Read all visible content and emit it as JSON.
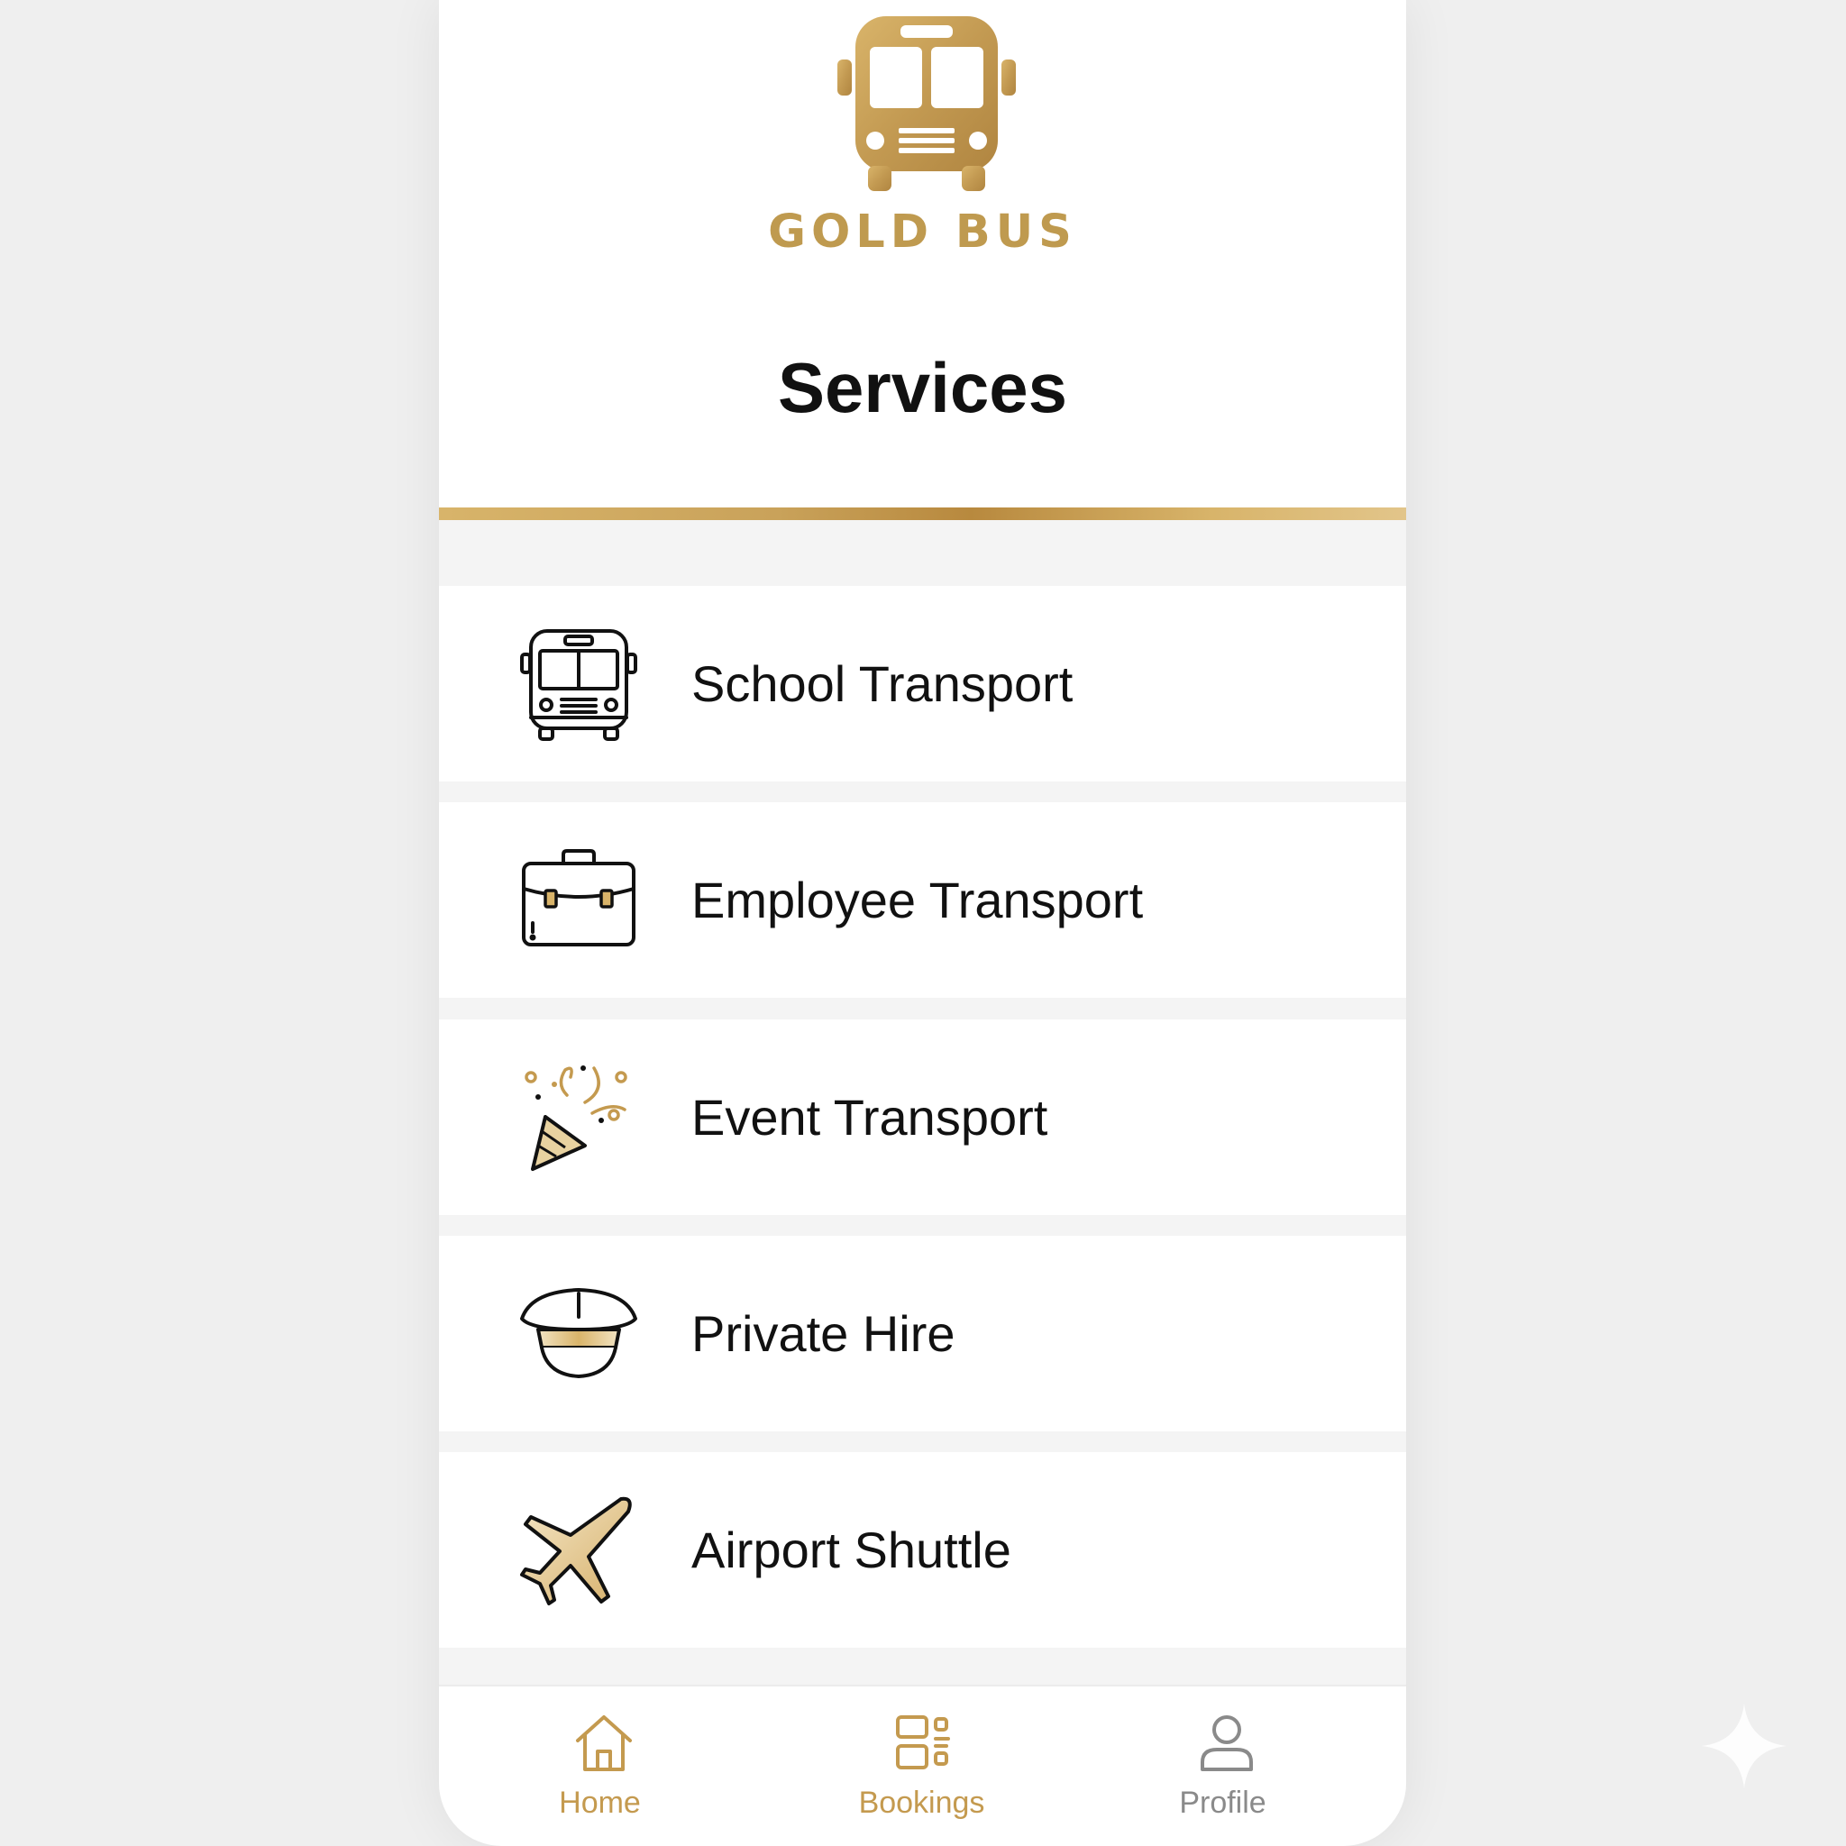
{
  "brand": {
    "name": "GOLD BUS",
    "logo_icon": "bus-icon"
  },
  "page": {
    "title": "Services"
  },
  "services": [
    {
      "label": "School Transport",
      "icon": "school-bus-icon"
    },
    {
      "label": "Employee Transport",
      "icon": "briefcase-icon"
    },
    {
      "label": "Event Transport",
      "icon": "party-popper-icon"
    },
    {
      "label": "Private Hire",
      "icon": "chauffeur-cap-icon"
    },
    {
      "label": "Airport Shuttle",
      "icon": "airplane-icon"
    }
  ],
  "tabbar": {
    "items": [
      {
        "label": "Home",
        "icon": "home-icon",
        "active": true
      },
      {
        "label": "Bookings",
        "icon": "bookings-icon",
        "active": true
      },
      {
        "label": "Profile",
        "icon": "profile-icon",
        "active": false
      }
    ]
  },
  "colors": {
    "gold": "#bf9a4f",
    "gold_dark": "#b8893e",
    "text": "#111111",
    "inactive": "#8a8a8a",
    "background": "#f4f4f4"
  }
}
